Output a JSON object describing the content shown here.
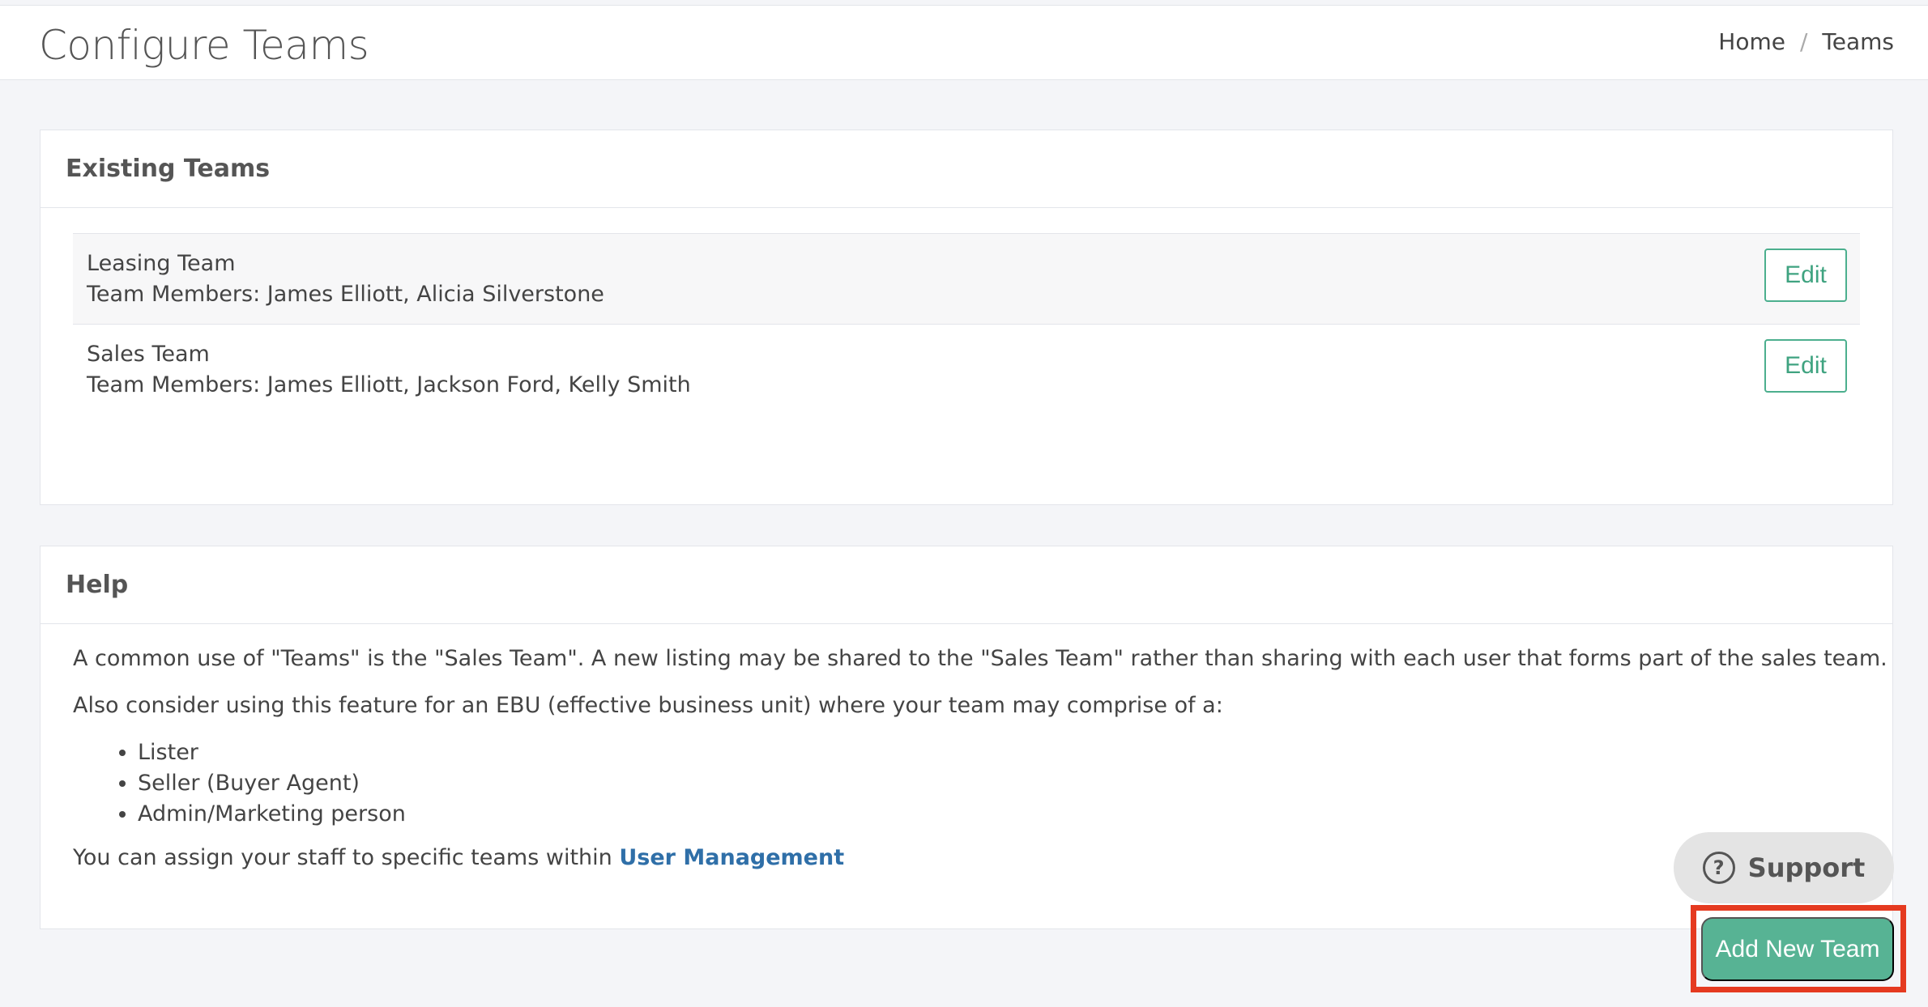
{
  "header": {
    "title": "Configure Teams",
    "breadcrumb": [
      {
        "label": "Home"
      },
      {
        "label": "Teams"
      }
    ],
    "separator": "/"
  },
  "existing_teams": {
    "heading": "Existing Teams",
    "teams": [
      {
        "name": "Leasing Team",
        "members": "Team Members: James Elliott, Alicia Silverstone",
        "edit_label": "Edit"
      },
      {
        "name": "Sales Team",
        "members": "Team Members: James Elliott, Jackson Ford, Kelly Smith",
        "edit_label": "Edit"
      }
    ]
  },
  "help": {
    "heading": "Help",
    "paragraph1": "A common use of \"Teams\" is the \"Sales Team\". A new listing may be shared to the \"Sales Team\" rather than sharing with each user that forms part of the sales team.",
    "paragraph2": "Also consider using this feature for an EBU (effective business unit) where your team may comprise of a:",
    "roles": [
      "Lister",
      "Seller (Buyer Agent)",
      "Admin/Marketing person"
    ],
    "assign_text": "You can assign your staff to specific teams within ",
    "assign_link": "User Management"
  },
  "support": {
    "label": "Support",
    "icon": "question-circle-icon",
    "icon_glyph": "?"
  },
  "actions": {
    "add_team_label": "Add New Team"
  }
}
